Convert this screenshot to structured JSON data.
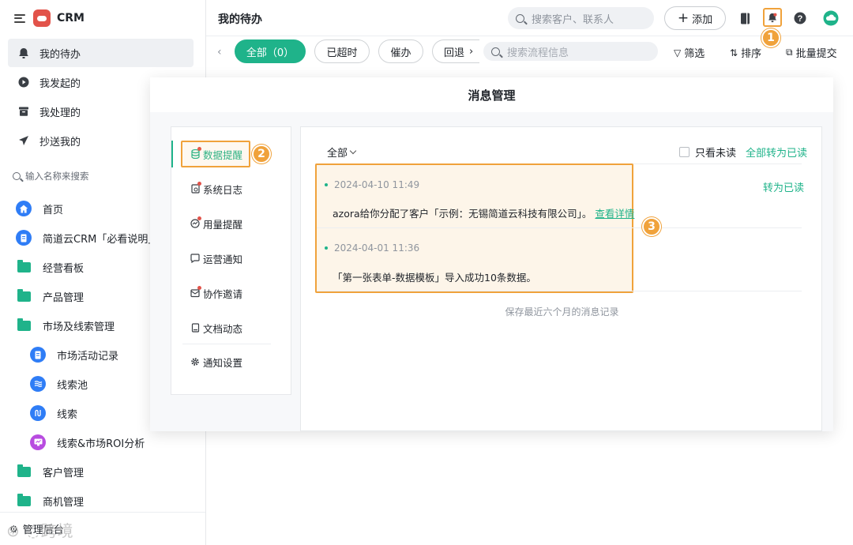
{
  "sidebar": {
    "app_name": "CRM",
    "nav": [
      {
        "label": "我的待办",
        "icon": "bell-icon",
        "active": true
      },
      {
        "label": "我发起的",
        "icon": "play-circle-icon"
      },
      {
        "label": "我处理的",
        "icon": "archive-box-icon"
      },
      {
        "label": "抄送我的",
        "icon": "paper-plane-icon"
      }
    ],
    "search_placeholder": "输入名称来搜索",
    "menu": [
      {
        "label": "首页",
        "icon": "home-icon"
      },
      {
        "label": "简道云CRM「必看说明」",
        "icon": "document-icon"
      },
      {
        "label": "经营看板",
        "icon": "folder-icon"
      },
      {
        "label": "产品管理",
        "icon": "folder-icon"
      },
      {
        "label": "市场及线索管理",
        "icon": "folder-open-icon"
      },
      {
        "label": "市场活动记录",
        "icon": "form-icon"
      },
      {
        "label": "线索池",
        "icon": "pool-icon"
      },
      {
        "label": "线索",
        "icon": "flow-icon"
      },
      {
        "label": "线索&市场ROI分析",
        "icon": "dashboard-icon"
      },
      {
        "label": "客户管理",
        "icon": "folder-icon"
      },
      {
        "label": "商机管理",
        "icon": "folder-icon"
      }
    ],
    "bottom_label": "管理后台",
    "watermark": "跨境"
  },
  "topbar": {
    "title": "我的待办",
    "search_placeholder": "搜索客户、联系人",
    "add_label": "添加",
    "step_1": "1"
  },
  "filters": {
    "tabs": [
      {
        "label": "全部（0）",
        "active": true
      },
      {
        "label": "已超时"
      },
      {
        "label": "催办"
      },
      {
        "label": "回退"
      }
    ],
    "search_placeholder": "搜索流程信息",
    "filter_label": "筛选",
    "sort_label": "排序",
    "batch_label": "批量提交"
  },
  "modal": {
    "title": "消息管理",
    "categories": [
      {
        "label": "数据提醒",
        "icon": "database-icon",
        "active": true,
        "unread": true
      },
      {
        "label": "系统日志",
        "icon": "log-icon",
        "unread": true
      },
      {
        "label": "用量提醒",
        "icon": "gauge-icon",
        "unread": true
      },
      {
        "label": "运营通知",
        "icon": "chat-icon"
      },
      {
        "label": "协作邀请",
        "icon": "mail-icon",
        "unread": true
      },
      {
        "label": "文档动态",
        "icon": "doc-icon"
      },
      {
        "label": "通知设置",
        "icon": "gear-icon"
      }
    ],
    "step_2": "2",
    "step_3": "3",
    "filter_label": "全部",
    "unread_only_label": "只看未读",
    "mark_all_label": "全部转为已读",
    "mark_read_label": "转为已读",
    "messages": [
      {
        "time": "2024-04-10 11:49",
        "text": "azora给你分配了客户「示例：无锡简道云科技有限公司」。",
        "link": "查看详情"
      },
      {
        "time": "2024-04-01 11:36",
        "text": "「第一张表单-数据模板」导入成功10条数据。"
      }
    ],
    "footnote": "保存最近六个月的消息记录"
  },
  "colors": {
    "accent": "#1fb38a",
    "highlight": "#f0a23b",
    "brand_red": "#e2534a"
  }
}
